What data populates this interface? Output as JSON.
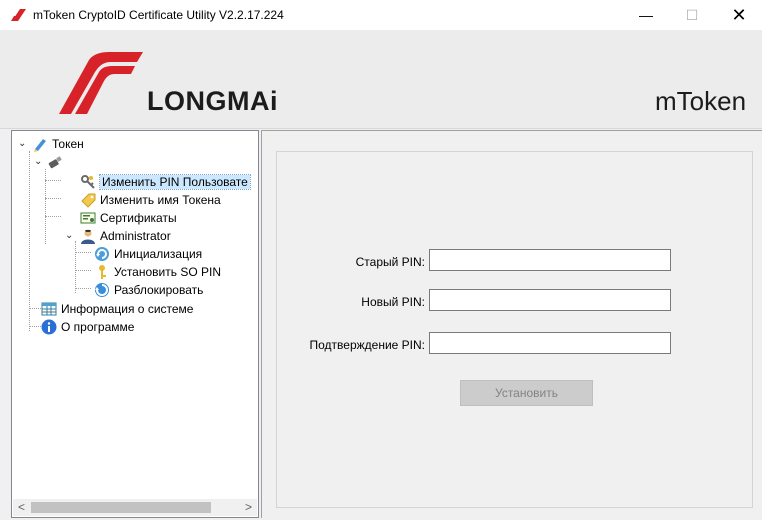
{
  "window": {
    "title": "mToken CryptoID Certificate Utility  V2.2.17.224",
    "controls": [
      "—",
      "☐",
      "✕"
    ]
  },
  "banner": {
    "brand": "LONGMAi",
    "product": "mToken"
  },
  "tree": {
    "root": "Токен",
    "items": [
      "Изменить PIN Пользовате",
      "Изменить имя Токена",
      "Сертификаты",
      "Administrator",
      "Инициализация",
      "Установить SO PIN",
      "Разблокировать",
      "Информация о системе",
      "О программе"
    ],
    "scroll_left": "<",
    "scroll_right": ">"
  },
  "form": {
    "old_pin_label": "Старый PIN:",
    "new_pin_label": "Новый PIN:",
    "confirm_pin_label": "Подтверждение PIN:",
    "old_pin_value": "",
    "new_pin_value": "",
    "confirm_pin_value": "",
    "submit_label": "Установить"
  }
}
